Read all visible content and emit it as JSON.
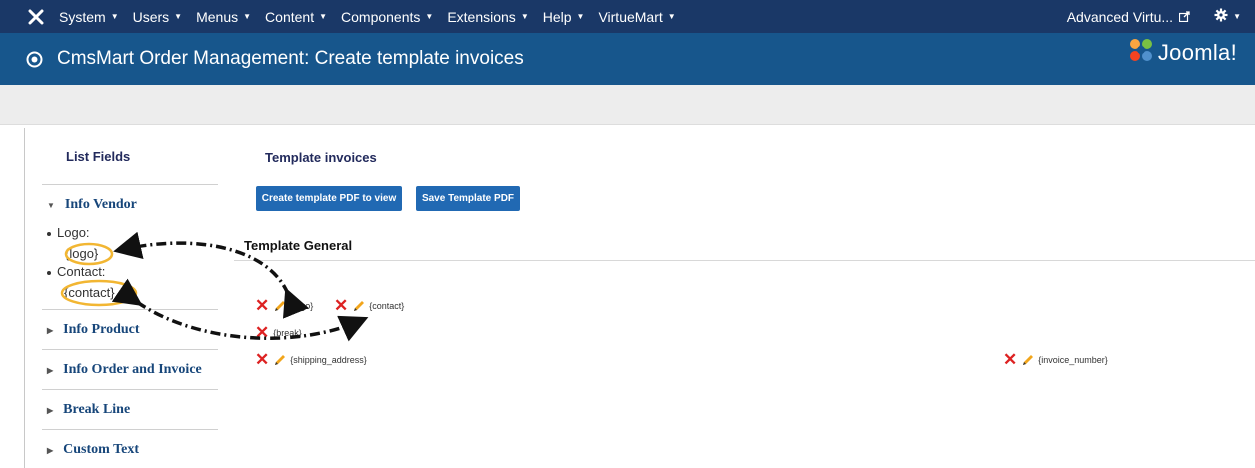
{
  "topbar": {
    "menus": [
      "System",
      "Users",
      "Menus",
      "Content",
      "Components",
      "Extensions",
      "Help",
      "VirtueMart"
    ],
    "site_link": "Advanced Virtu..."
  },
  "titlebar": {
    "page_title": "CmsMart Order Management: Create template invoices",
    "brand": "Joomla!"
  },
  "sidebar": {
    "title": "List Fields",
    "sections": [
      "Info Vendor",
      "Info Product",
      "Info Order and Invoice",
      "Break Line",
      "Custom Text"
    ],
    "fields": [
      {
        "label": "Logo:",
        "tag": "{logo}"
      },
      {
        "label": "Contact:",
        "tag": "{contact}"
      }
    ]
  },
  "main": {
    "title": "Template invoices",
    "create_button": "Create template PDF to view",
    "save_button": "Save Template PDF",
    "section_title": "Template General",
    "items": [
      "{logo}",
      "{contact}",
      "{break}",
      "{shipping_address}",
      "{invoice_number}"
    ]
  },
  "colors": {
    "topbar": "#1a3867",
    "titlebar": "#17568c",
    "button": "#2169b3",
    "delete": "#dd2222",
    "highlight": "#f2b632"
  }
}
